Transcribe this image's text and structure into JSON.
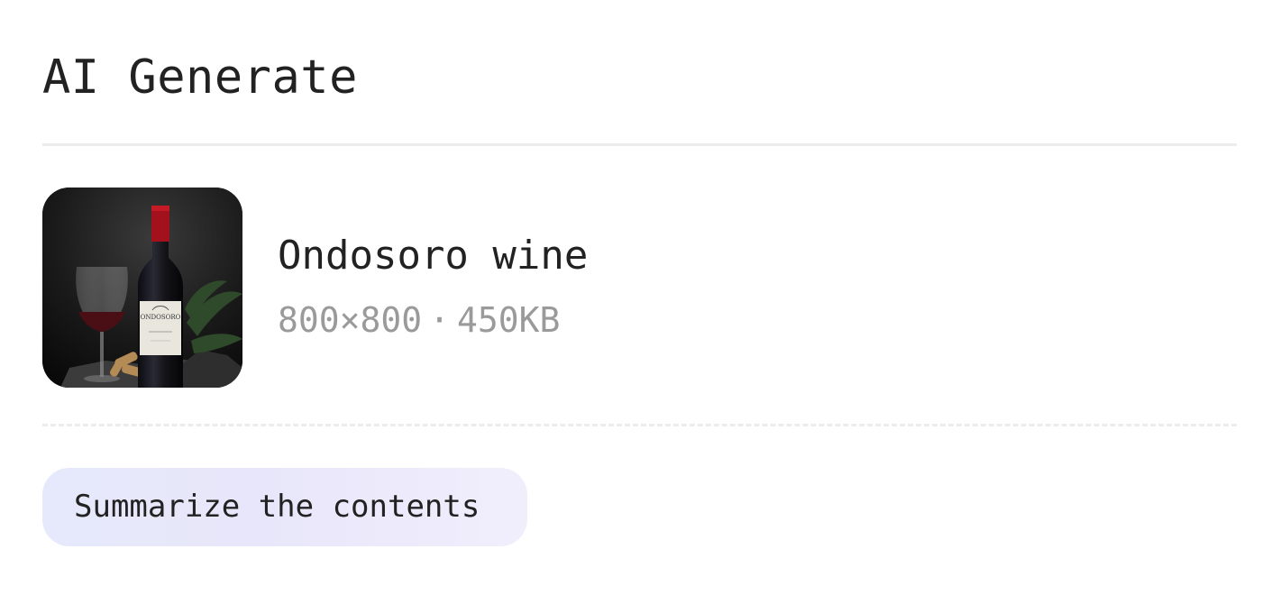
{
  "panel": {
    "title": "AI Generate"
  },
  "file": {
    "name": "Ondosoro wine",
    "dimensions": "800×800",
    "separator": "·",
    "size": "450KB",
    "thumbnail_label": "ONDOSORO"
  },
  "suggestions": [
    {
      "label": "Summarize the contents"
    }
  ],
  "colors": {
    "text_primary": "#222222",
    "text_muted": "#9a9a9a",
    "divider": "#ececec",
    "chip_gradient_start": "#e6e9fb",
    "chip_gradient_end": "#f1eefc"
  }
}
